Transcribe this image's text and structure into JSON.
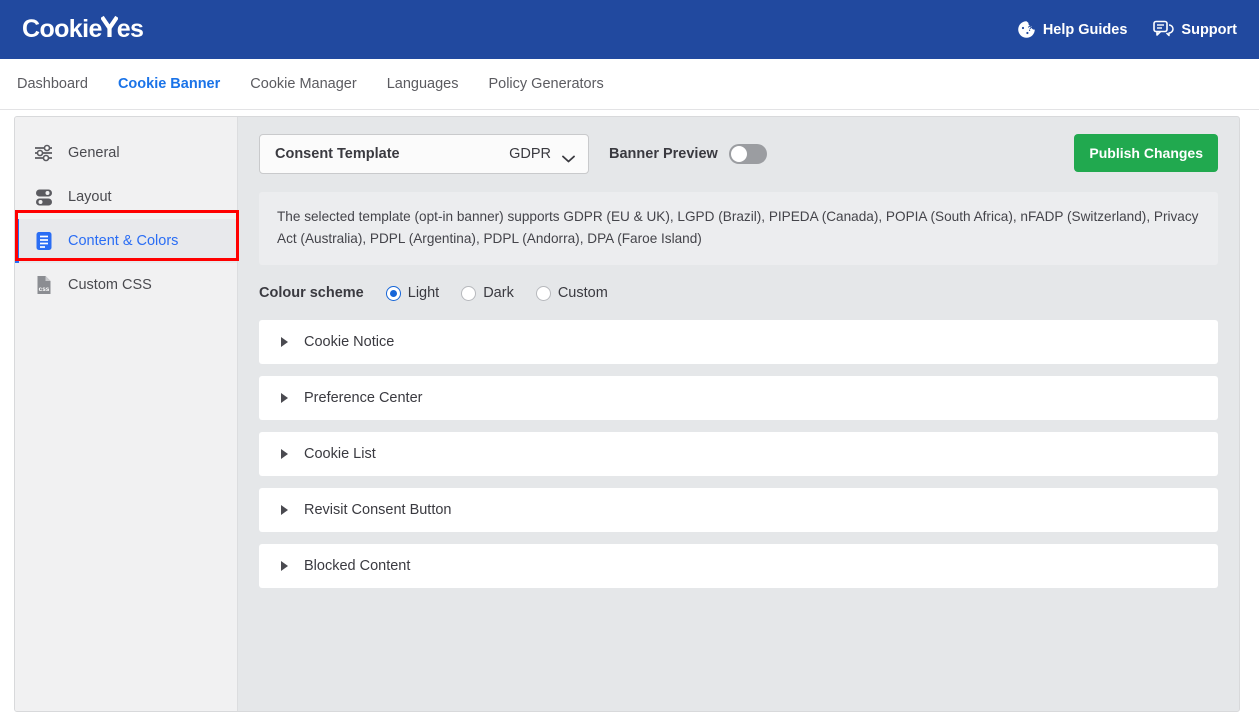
{
  "header": {
    "logo_text_1": "Cookie",
    "logo_text_2": "es",
    "help_label": "Help Guides",
    "support_label": "Support",
    "brand_color": "#21499f"
  },
  "nav": {
    "items": [
      {
        "label": "Dashboard",
        "active": false
      },
      {
        "label": "Cookie Banner",
        "active": true
      },
      {
        "label": "Cookie Manager",
        "active": false
      },
      {
        "label": "Languages",
        "active": false
      },
      {
        "label": "Policy Generators",
        "active": false
      }
    ],
    "active_color": "#1a73e8"
  },
  "sidebar": {
    "items": [
      {
        "label": "General",
        "icon": "sliders-icon"
      },
      {
        "label": "Layout",
        "icon": "layout-toggles-icon"
      },
      {
        "label": "Content & Colors",
        "icon": "content-document-icon"
      },
      {
        "label": "Custom CSS",
        "icon": "css-file-icon"
      }
    ],
    "active_index": 2,
    "active_color": "#2a6df4",
    "highlight_color": "#ff0000"
  },
  "toolbar": {
    "consent_template_label": "Consent Template",
    "consent_template_value": "GDPR",
    "banner_preview_label": "Banner Preview",
    "banner_preview_on": false,
    "publish_label": "Publish Changes",
    "publish_color": "#21a94f"
  },
  "notice": {
    "text": "The selected template (opt-in banner) supports GDPR (EU & UK), LGPD (Brazil), PIPEDA (Canada), POPIA (South Africa), nFADP (Switzerland), Privacy Act (Australia), PDPL (Argentina), PDPL (Andorra), DPA (Faroe Island)"
  },
  "colour_scheme": {
    "label": "Colour scheme",
    "options": [
      {
        "label": "Light",
        "selected": true
      },
      {
        "label": "Dark",
        "selected": false
      },
      {
        "label": "Custom",
        "selected": false
      }
    ],
    "selected_color": "#1565d8"
  },
  "accordions": {
    "items": [
      {
        "label": "Cookie Notice",
        "expanded": false
      },
      {
        "label": "Preference Center",
        "expanded": false
      },
      {
        "label": "Cookie List",
        "expanded": false
      },
      {
        "label": "Revisit Consent Button",
        "expanded": false
      },
      {
        "label": "Blocked Content",
        "expanded": false
      }
    ]
  }
}
